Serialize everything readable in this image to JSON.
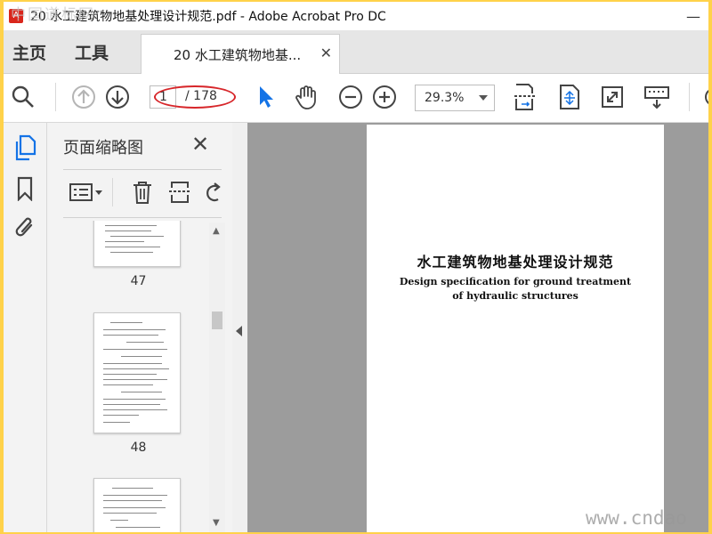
{
  "window": {
    "title": "20 水工建筑物地基处理设计规范.pdf - Adobe Acrobat Pro DC",
    "minimize_glyph": "—",
    "close_glyph": "✕"
  },
  "watermark_top": "中国道标网",
  "tabs": {
    "home": "主页",
    "tools": "工具",
    "document": "20 水工建筑物地基...",
    "close_glyph": "✕"
  },
  "toolbar": {
    "page_current": "1",
    "page_total": "/ 178",
    "zoom": "29.3%"
  },
  "panel": {
    "title": "页面缩略图",
    "close_glyph": "✕"
  },
  "thumbnails": [
    {
      "label": "47"
    },
    {
      "label": "48"
    }
  ],
  "document": {
    "title_cn": "水工建筑物地基处理设计规范",
    "title_en_line1": "Design specification for ground treatment",
    "title_en_line2": "of hydraulic structures"
  },
  "watermark_bottom": "www.cndao",
  "colors": {
    "accent_blue": "#1473e6",
    "highlight_red": "#d7262a",
    "outer_border": "#ffd24a"
  }
}
